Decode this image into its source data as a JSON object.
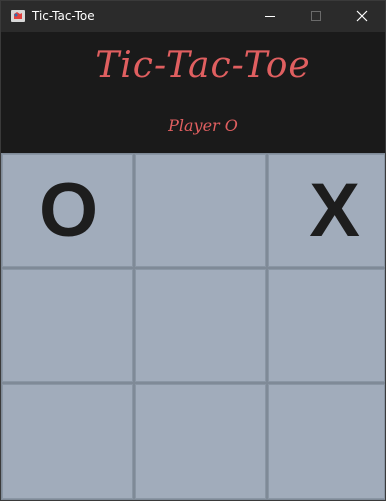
{
  "window": {
    "title": "Tic-Tac-Toe"
  },
  "header": {
    "title": "Tic-Tac-Toe",
    "status": "Player O",
    "accent_color": "#e05f60"
  },
  "board": {
    "cells": [
      "O",
      "",
      "X",
      "",
      "",
      "",
      "",
      "",
      ""
    ]
  }
}
